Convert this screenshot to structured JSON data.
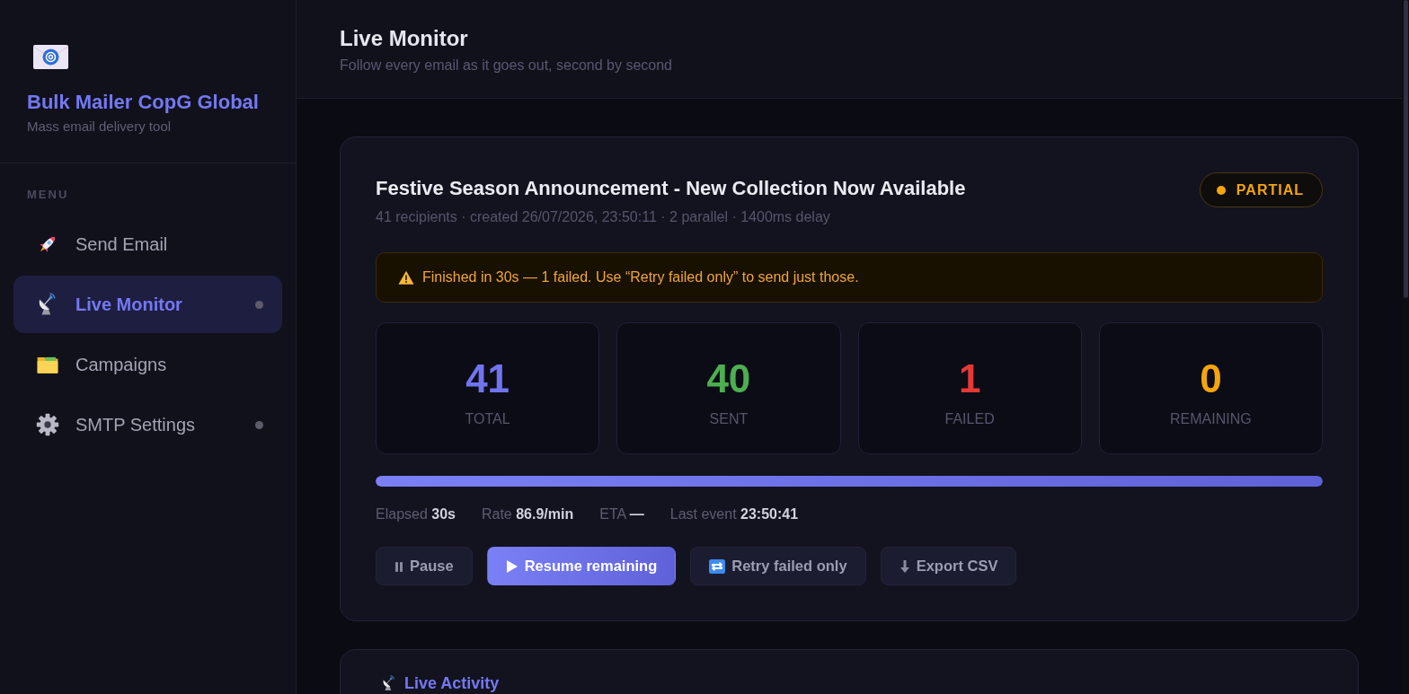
{
  "sidebar": {
    "brand": {
      "title": "Bulk Mailer CopG Global",
      "subtitle": "Mass email delivery tool"
    },
    "menu_label": "MENU",
    "items": [
      {
        "label": "Send Email",
        "selected": false,
        "indicator": false
      },
      {
        "label": "Live Monitor",
        "selected": true,
        "indicator": true
      },
      {
        "label": "Campaigns",
        "selected": false,
        "indicator": false
      },
      {
        "label": "SMTP Settings",
        "selected": false,
        "indicator": true
      }
    ]
  },
  "header": {
    "title": "Live Monitor",
    "subtitle": "Follow every email as it goes out, second by second"
  },
  "campaign": {
    "title": "Festive Season Announcement - New Collection Now Available",
    "meta": "41 recipients · created 26/07/2026, 23:50:11 · 2 parallel · 1400ms delay",
    "status": {
      "kind": "partial",
      "label": "PARTIAL"
    },
    "alert": {
      "kind": "warning",
      "text": "Finished in 30s — 1 failed. Use “Retry failed only” to send just those."
    },
    "stats": [
      {
        "value": "41",
        "label": "TOTAL",
        "color": "#7174f0"
      },
      {
        "value": "40",
        "label": "SENT",
        "color": "#4caf50"
      },
      {
        "value": "1",
        "label": "FAILED",
        "color": "#e53935"
      },
      {
        "value": "0",
        "label": "REMAINING",
        "color": "#f5a50b"
      }
    ],
    "progress": {
      "level": 1
    },
    "metrics": [
      "Elapsed **30s**",
      "Rate **86.9/min**",
      "ETA **—**",
      "Last event **23:50:41**"
    ],
    "actions": [
      {
        "label": "Pause",
        "kind": "secondary"
      },
      {
        "label": "Resume remaining",
        "kind": "primary"
      },
      {
        "label": "Retry failed only",
        "kind": "secondary"
      },
      {
        "label": "Export CSV",
        "kind": "secondary"
      }
    ]
  },
  "activity": {
    "title": "Live Activity"
  }
}
